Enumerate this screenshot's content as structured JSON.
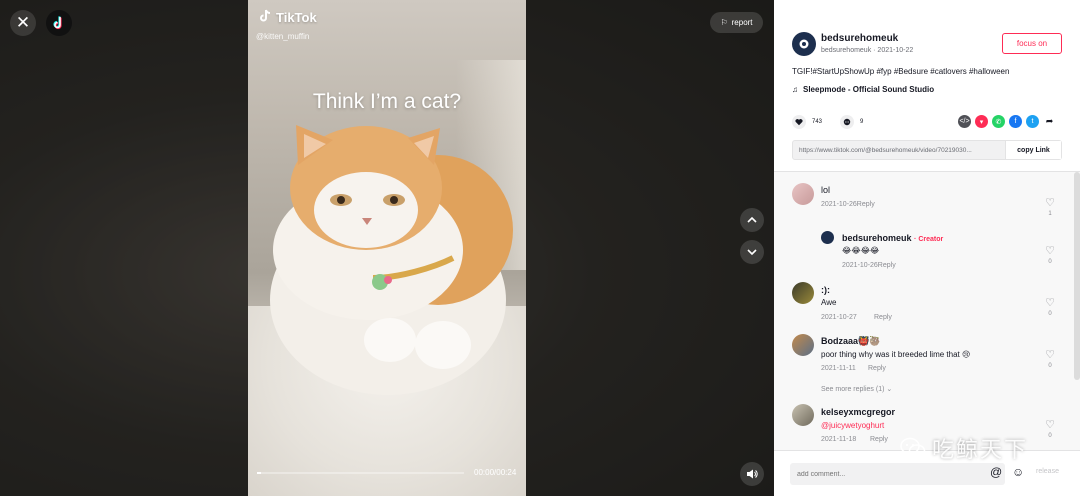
{
  "video": {
    "brand": "TikTok",
    "username": "@kitten_muffin",
    "caption": "Think I’m a cat?",
    "progress": 0.02,
    "time": "00:00/00:24",
    "report_label": "report"
  },
  "author": {
    "name": "bedsurehomeuk",
    "sub": "bedsurehomeuk · 2021-10-22",
    "follow_label": "focus on"
  },
  "description": "TGIF!#StartUpShowUp #fyp #Bedsure #catlovers #halloween",
  "music": "Sleepmode - Official Sound Studio",
  "stats": {
    "likes": "743",
    "comments": "9"
  },
  "link": {
    "url": "https://www.tiktok.com/@bedsurehomeuk/video/70219030...",
    "copy_label": "copy Link"
  },
  "comments": [
    {
      "name": "lol",
      "text": "",
      "meta": "2021-10-26Reply",
      "likes": "1"
    },
    {
      "name": "bedsurehomeuk",
      "badge": "· Creator",
      "text": "😂😂😂😂",
      "meta": "2021-10-26Reply",
      "likes": "0"
    },
    {
      "name": ":):",
      "text": "Awe",
      "meta": "2021-10-27",
      "reply": "Reply",
      "likes": "0"
    },
    {
      "name": "Bodzaaa👹🦥",
      "text": "poor thing why was it breeded lime that 😢",
      "meta": "2021-11-11",
      "reply": "Reply",
      "likes": "0",
      "see_more": "See more replies (1)"
    },
    {
      "name": "kelseyxmcgregor",
      "text": "@juicywetyoghurt",
      "meta": "2021-11-18",
      "reply": "Reply",
      "likes": "0"
    }
  ],
  "comment_bar": {
    "placeholder": "add comment...",
    "post_label": "release"
  },
  "watermark": "吃鲸天下",
  "colors": {
    "accent": "#fe2c55",
    "link_text": "#fe2c55",
    "panel_bg": "#ffffff"
  },
  "icons": [
    "close-icon",
    "tiktok-logo-icon",
    "flag-icon",
    "chevron-up-icon",
    "chevron-down-icon",
    "volume-icon",
    "heart-icon",
    "comment-icon",
    "embed-icon",
    "send-icon",
    "whatsapp-icon",
    "facebook-icon",
    "twitter-icon",
    "share-arrow-icon",
    "music-note-icon",
    "mention-icon",
    "emoji-icon",
    "wechat-icon"
  ]
}
